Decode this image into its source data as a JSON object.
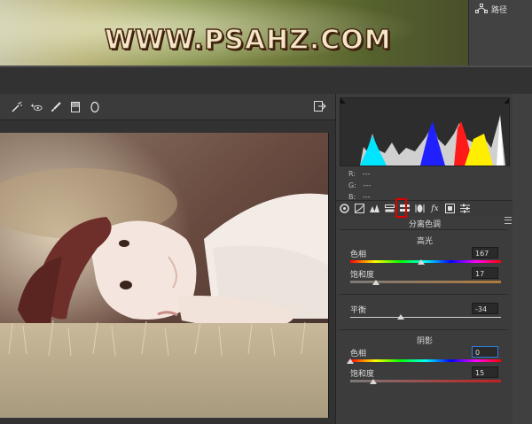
{
  "watermark": "WWW.PSAHZ.COM",
  "paths_panel": {
    "icon": "path-icon",
    "label": "路径"
  },
  "toolbar": {
    "tools": [
      "white-balance-tool-icon",
      "red-eye-tool-icon",
      "brush-tool-icon",
      "graduated-filter-icon",
      "radial-filter-icon"
    ],
    "export_icon": "export-icon"
  },
  "histogram": {
    "rgb_labels": [
      "R:",
      "G:",
      "B:"
    ],
    "rgb_values": [
      "---",
      "---",
      "---"
    ]
  },
  "tabs": [
    "basic-icon",
    "tone-curve-icon",
    "detail-icon",
    "hsl-icon",
    "split-toning-icon",
    "lens-corrections-icon",
    "fx-icon",
    "camera-calibration-icon",
    "presets-icon"
  ],
  "split_toning": {
    "title": "分离色调",
    "highlights": {
      "title": "高光",
      "hue_label": "色相",
      "hue_value": "167",
      "saturation_label": "饱和度",
      "saturation_value": "17"
    },
    "balance": {
      "label": "平衡",
      "value": "-34"
    },
    "shadows": {
      "title": "阴影",
      "hue_label": "色相",
      "hue_value": "0",
      "saturation_label": "饱和度",
      "saturation_value": "15"
    }
  },
  "colors": {
    "highlight_box": "#e00000",
    "focus": "#2f7cd8"
  }
}
